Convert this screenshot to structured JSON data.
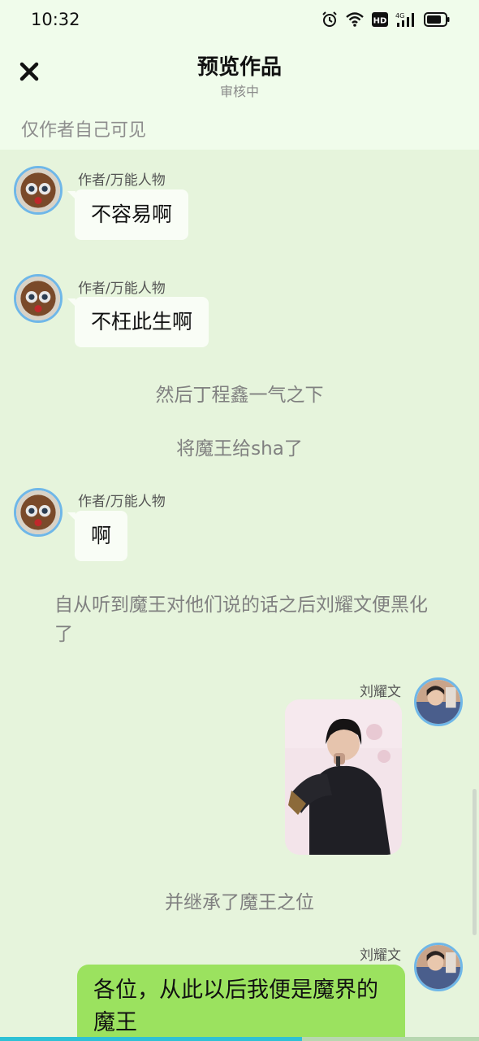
{
  "status_bar": {
    "time": "10:32",
    "icons": [
      "alarm-icon",
      "wifi-icon",
      "hd-icon",
      "cellular-4g-icon",
      "battery-icon"
    ],
    "network_label": "4G",
    "hd_label": "HD"
  },
  "header": {
    "close_icon": "close-icon",
    "title": "预览作品",
    "subtitle": "审核中"
  },
  "visibility_note": "仅作者自己可见",
  "messages": [
    {
      "name": "作者/万能人物",
      "text": "不容易啊"
    },
    {
      "name": "作者/万能人物",
      "text": "不枉此生啊"
    },
    {
      "narration": "然后丁程鑫一气之下"
    },
    {
      "narration": "将魔王给sha了"
    },
    {
      "name": "作者/万能人物",
      "text": "啊"
    },
    {
      "narration": "自从听到魔王对他们说的话之后刘耀文便黑化了"
    },
    {
      "name": "刘耀文",
      "image": "photo-performer"
    },
    {
      "narration": "并继承了魔王之位"
    },
    {
      "name": "刘耀文",
      "text": "各位，从此以后我便是魔界的魔王"
    }
  ],
  "colors": {
    "background": "#e6f4dc",
    "header_bg": "#f0fceb",
    "bubble_left": "#f9fdf6",
    "bubble_right": "#9be25f",
    "avatar_border": "#6fb7e8",
    "narration_text": "#808080",
    "progress": "#2ec1d5"
  },
  "reading_progress": 0.63
}
